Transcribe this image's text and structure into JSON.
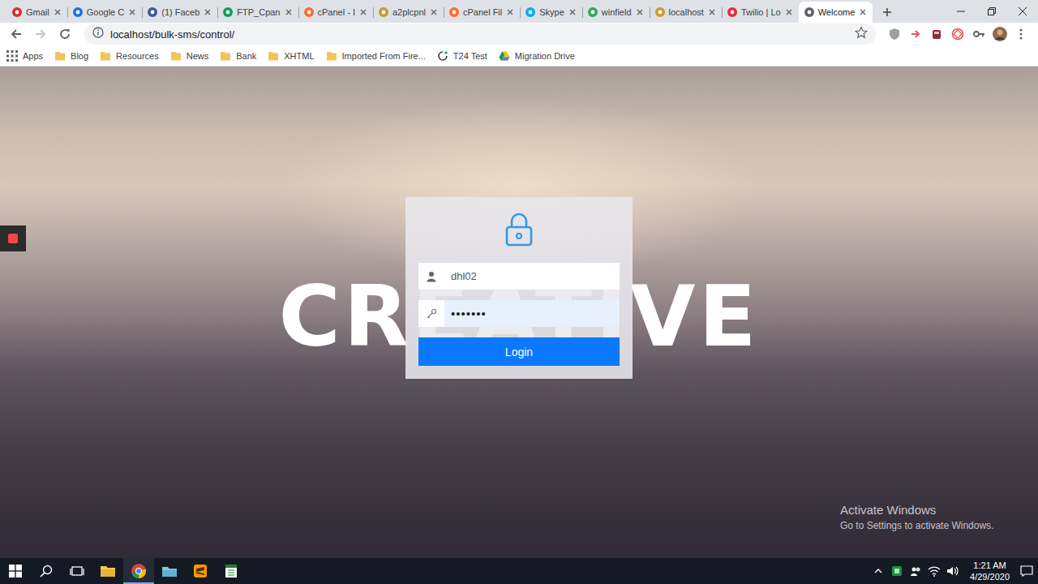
{
  "browser": {
    "tabs": [
      {
        "label": "Gmail",
        "selected": false,
        "color": "#d93025"
      },
      {
        "label": "Google C",
        "selected": false,
        "color": "#1a73e8"
      },
      {
        "label": "(1) Faceb",
        "selected": false,
        "color": "#3b5998"
      },
      {
        "label": "FTP_Cpan",
        "selected": false,
        "color": "#0f9d58"
      },
      {
        "label": "cPanel - I",
        "selected": false,
        "color": "#ff6c2c"
      },
      {
        "label": "a2plcpnl",
        "selected": false,
        "color": "#c99a2e"
      },
      {
        "label": "cPanel Fil",
        "selected": false,
        "color": "#ff6c2c"
      },
      {
        "label": "Skype",
        "selected": false,
        "color": "#00aff0"
      },
      {
        "label": "winfield",
        "selected": false,
        "color": "#34a853"
      },
      {
        "label": "localhost",
        "selected": false,
        "color": "#c99a2e"
      },
      {
        "label": "Twilio | Lo",
        "selected": false,
        "color": "#e22c3b"
      },
      {
        "label": "Welcome",
        "selected": true,
        "color": "#5f6368"
      }
    ],
    "address": "localhost/bulk-sms/control/",
    "bookmarks": [
      {
        "label": "Apps",
        "kind": "apps"
      },
      {
        "label": "Blog",
        "kind": "folder"
      },
      {
        "label": "Resources",
        "kind": "folder"
      },
      {
        "label": "News",
        "kind": "folder"
      },
      {
        "label": "Bank",
        "kind": "folder"
      },
      {
        "label": "XHTML",
        "kind": "folder"
      },
      {
        "label": "Imported From Fire...",
        "kind": "folder"
      },
      {
        "label": "T24 Test",
        "kind": "link"
      },
      {
        "label": "Migration Drive",
        "kind": "drive"
      }
    ]
  },
  "page": {
    "hero_text": "CREATIVE",
    "login": {
      "username": "dhl02",
      "password": "•••••••",
      "button": "Login"
    }
  },
  "watermark": {
    "title": "Activate Windows",
    "subtitle": "Go to Settings to activate Windows."
  },
  "taskbar": {
    "time": "1:21 AM",
    "date": "4/29/2020"
  }
}
